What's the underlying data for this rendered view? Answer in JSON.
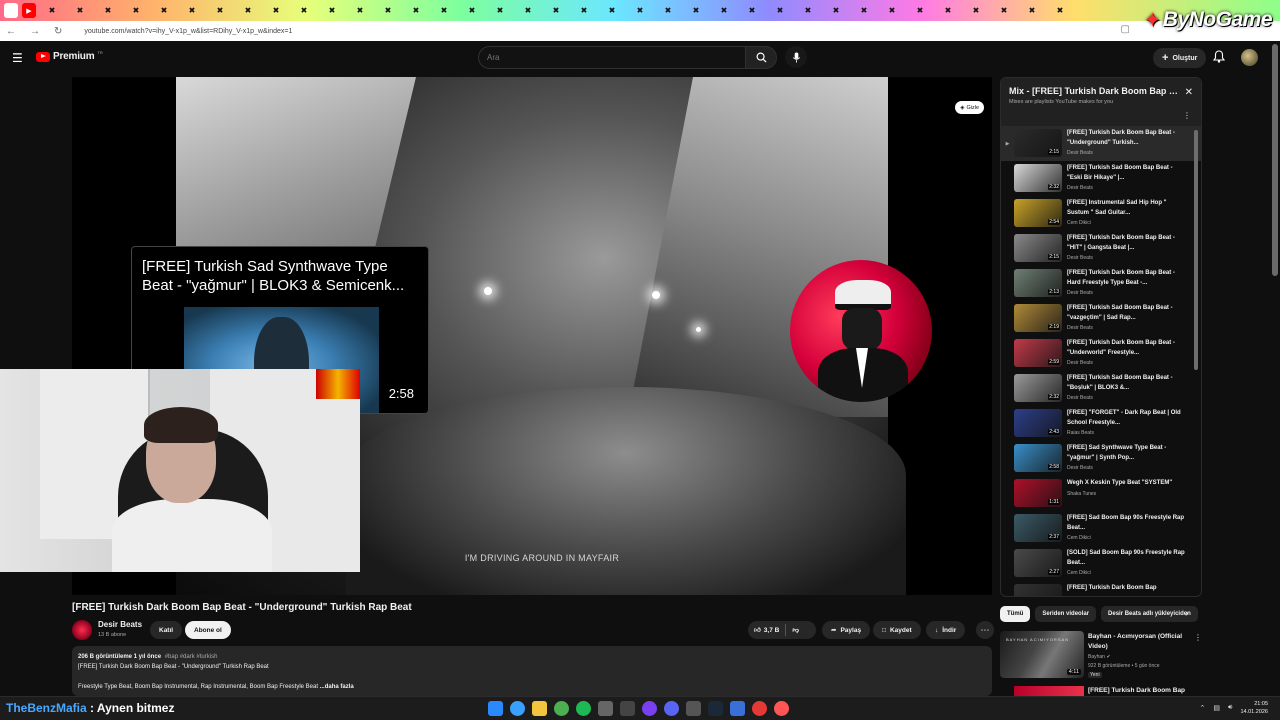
{
  "browser": {
    "url": "youtube.com/watch?v=ihy_V-x1p_w&list=RDihy_V-x1p_w&index=1",
    "brand_overlay": "ByNoGame"
  },
  "masthead": {
    "logo_text": "Premium",
    "logo_country": "TR",
    "search_placeholder": "Ara",
    "create_label": "Oluştur"
  },
  "player": {
    "subtitle": "I'M DRIVING AROUND IN MAYFAIR",
    "hide_label": "Gizle",
    "endcard": {
      "title": "[FREE] Turkish Sad Synthwave Type Beat - \"yağmur\" | BLOK3 & Semicenk...",
      "duration": "2:58"
    }
  },
  "video": {
    "title": "[FREE] Turkish Dark Boom Bap Beat - \"Underground\" Turkish Rap Beat",
    "channel_name": "Desir Beats",
    "channel_subs": "13 B abone",
    "join_label": "Katıl",
    "subscribe_label": "Abone ol",
    "likes": "3,7 B",
    "share_label": "Paylaş",
    "save_label": "Kaydet",
    "download_label": "İndir",
    "description": {
      "stats": "206 B görüntüleme  1 yıl önce",
      "tags": "#bap #dark #turkish",
      "line1": "[FREE] Turkish Dark Boom Bap Beat - \"Underground\" Turkish Rap Beat",
      "line2": "Freestyle Type Beat, Boom Bap Instrumental, Rap Instrumental, Boom Bap Freestyle Beat",
      "more": "...daha fazla"
    }
  },
  "playlist": {
    "title": "Mix - [FREE] Turkish Dark Boom Bap Beat - \"Underground\" Turkish Rap Beat",
    "subtitle": "Mixes are playlists YouTube makes for you",
    "items": [
      {
        "title": "[FREE] Turkish Dark Boom Bap Beat - \"Underground\" Turkish...",
        "channel": "Desir Beats",
        "duration": "2:15",
        "active": true,
        "thumb": "#2b2b2b"
      },
      {
        "title": "[FREE] Turkish Sad Boom Bap Beat - \"Eski Bir Hikaye\" |...",
        "channel": "Desir Beats",
        "duration": "2:32",
        "thumb": "#d9d9d9"
      },
      {
        "title": "[FREE] Instrumental Sad Hip Hop \" Sustum \" Sad Guitar...",
        "channel": "Cem Dikici",
        "duration": "2:54",
        "thumb": "#c9a227"
      },
      {
        "title": "[FREE] Turkish Dark Boom Bap Beat - \"HIT\" | Gangsta Beat |...",
        "channel": "Desir Beats",
        "duration": "2:15",
        "thumb": "#8a8a8a"
      },
      {
        "title": "[FREE] Turkish Dark Boom Bap Beat - Hard Freestyle Type Beat -...",
        "channel": "Desir Beats",
        "duration": "2:13",
        "thumb": "#6f7f73"
      },
      {
        "title": "[FREE] Turkish Sad Boom Bap Beat - \"vazgeçtim\" | Sad Rap...",
        "channel": "Desir Beats",
        "duration": "2:19",
        "thumb": "#b08a3a"
      },
      {
        "title": "[FREE] Turkish Dark Boom Bap Beat - \"Underworld\" Freestyle...",
        "channel": "Desir Beats",
        "duration": "2:59",
        "thumb": "#c23a4a"
      },
      {
        "title": "[FREE] Turkish Sad Boom Bap Beat - \"Boşluk\" | BLOK3 &...",
        "channel": "Desir Beats",
        "duration": "2:32",
        "thumb": "#9a9a9a"
      },
      {
        "title": "[FREE] \"FORGET\" - Dark Rap Beat | Old School Freestyle...",
        "channel": "Raias Beats",
        "duration": "2:43",
        "thumb": "#2d3f8a"
      },
      {
        "title": "[FREE] Sad Synthwave Type Beat - \"yağmur\" | Synth Pop...",
        "channel": "Desir Beats",
        "duration": "2:58",
        "thumb": "#3a8fc9"
      },
      {
        "title": "Wegh X Keskin Type Beat \"SYSTEM\"",
        "channel": "Shaka Tunes",
        "duration": "1:31",
        "thumb": "#b0102a"
      },
      {
        "title": "[FREE] Sad Boom Bap 90s Freestyle Rap Beat...",
        "channel": "Cem Dikici",
        "duration": "2:37",
        "thumb": "#3b5a66"
      },
      {
        "title": "[SOLD] Sad Boom Bap 90s Freestyle Rap Beat...",
        "channel": "Cem Dikici",
        "duration": "2:27",
        "thumb": "#4a4a4a"
      },
      {
        "title": "[FREE] Turkish Dark Boom Bap",
        "channel": "",
        "duration": "",
        "thumb": "#333333"
      }
    ]
  },
  "chips": [
    "Tümü",
    "Seriden videolar",
    "Desir Beats adlı yükleyiciden"
  ],
  "recommendations": [
    {
      "title": "Bayhan - Acımıyorsan (Official Video)",
      "channel": "Bayhan",
      "meta": "922 B görüntüleme • 5 gün önce",
      "badge": "Yeni",
      "duration": "4:11",
      "thumb_text": "BAYHAN   ACIMIYORSAN"
    },
    {
      "title": "[FREE] Turkish Dark Boom Bap"
    }
  ],
  "taskbar": {
    "overlay_handle": "TheBenzMafia",
    "overlay_message": ": Aynen bitmez",
    "time": "21:05",
    "date": "14.01.2026"
  },
  "colors": {
    "background": "#0f0f0f",
    "accent_red": "#ff0000",
    "chip_bg": "#272727"
  }
}
